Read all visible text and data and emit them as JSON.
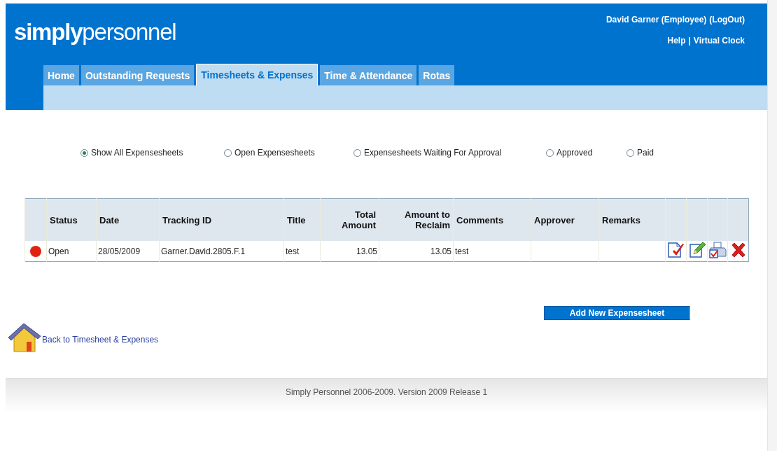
{
  "header": {
    "logo": "**simply**personnel",
    "user": "David Garner (Employee)",
    "logout": "(LogOut)",
    "help": "Help",
    "separator": "|",
    "virtual_clock": "Virtual Clock"
  },
  "tabs": [
    {
      "label": "Home",
      "selected": false
    },
    {
      "label": "Outstanding Requests",
      "selected": false
    },
    {
      "label": "Timesheets & Expenses",
      "selected": true
    },
    {
      "label": "Time & Attendance",
      "selected": false
    },
    {
      "label": "Rotas",
      "selected": false
    }
  ],
  "filters": [
    {
      "label": "Show All Expensesheets",
      "selected": true
    },
    {
      "label": "Open Expensesheets",
      "selected": false
    },
    {
      "label": "Expensesheets Waiting For Approval",
      "selected": false
    },
    {
      "label": "Approved",
      "selected": false
    },
    {
      "label": "Paid",
      "selected": false
    }
  ],
  "table": {
    "columns": [
      "Status",
      "Date",
      "Tracking ID",
      "Title",
      "Total Amount",
      "Amount to Reclaim",
      "Comments",
      "Approver",
      "Remarks"
    ],
    "rows": [
      {
        "color": "#e0230f",
        "cells": [
          "Open",
          "28/05/2009",
          "Garner.David.2805.F.1",
          "test",
          "13.05",
          "13.05",
          "test",
          "",
          ""
        ]
      }
    ]
  },
  "back_link": "Back to Timesheet & Expenses",
  "add_button": "Add New Expensesheet",
  "footer": "Simply Personnel 2006-2009. Version 2009 Release 1"
}
